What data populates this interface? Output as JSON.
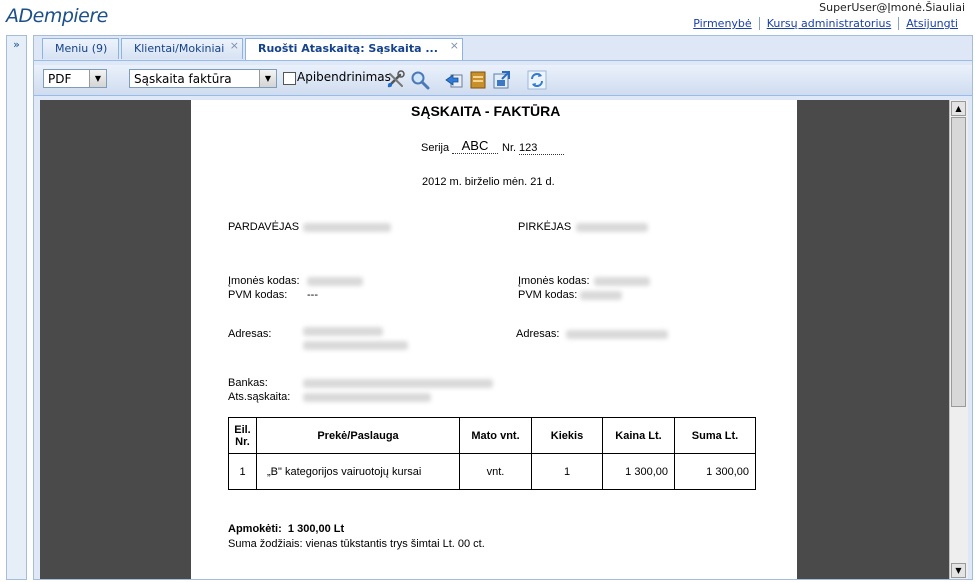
{
  "app": {
    "logo": "ADempiere"
  },
  "header": {
    "user": "SuperUser@Įmonė.Šiauliai",
    "links": [
      "Pirmenybė",
      "Kursų administratorius",
      "Atsijungti"
    ]
  },
  "tabs": [
    {
      "label": "Meniu (9)",
      "closable": false
    },
    {
      "label": "Klientai/Mokiniai",
      "closable": true
    },
    {
      "label": "Ruošti Ataskaitą: Sąskaita ...",
      "closable": true
    }
  ],
  "toolbar": {
    "format": "PDF",
    "report": "Sąskaita faktūra",
    "summary_label": "Apibendrinimas",
    "icons": [
      "customize-icon",
      "zoom-icon",
      "back-icon",
      "archive-icon",
      "export-icon",
      "refresh-icon"
    ]
  },
  "invoice": {
    "title": "SĄSKAITA - FAKTŪRA",
    "serija_label": "Serija",
    "serija_value": "ABC",
    "nr_label": "Nr.",
    "nr_value": "123",
    "date": "2012 m.  birželio  mėn.  21 d.",
    "seller_label": "PARDAVĖJAS",
    "buyer_label": "PIRKĖJAS",
    "company_code_label": "Įmonės kodas:",
    "vat_code_label": "PVM kodas:",
    "seller_vat": "---",
    "address_label": "Adresas:",
    "bank_label": "Bankas:",
    "account_label": "Ats.sąskaita:",
    "table_headers": [
      "Eil. Nr.",
      "Prekė/Paslauga",
      "Mato vnt.",
      "Kiekis",
      "Kaina Lt.",
      "Suma Lt."
    ],
    "rows": [
      [
        "1",
        "„B\" kategorijos vairuotojų kursai",
        "vnt.",
        "1",
        "1 300,00",
        "1 300,00"
      ]
    ],
    "total_label": "Apmokėti:",
    "total_value": "1 300,00 Lt",
    "words": "Suma žodžiais:  vienas tūkstantis trys šimtai Lt. 00 ct."
  }
}
